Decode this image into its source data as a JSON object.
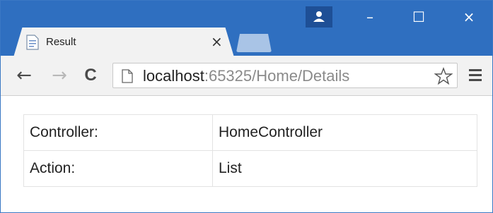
{
  "browser": {
    "tab_title": "Result",
    "tab_close_glyph": "×",
    "window_controls": {
      "minimize": "–",
      "maximize": "☐",
      "close": "×"
    },
    "url_host": "localhost",
    "url_path": ":65325/Home/Details",
    "icons": [
      "user-icon",
      "back-icon",
      "forward-icon",
      "reload-icon",
      "page-icon",
      "star-icon",
      "menu-icon"
    ]
  },
  "nav": {
    "back": "←",
    "forward": "→",
    "reload": "C"
  },
  "table": {
    "rows": [
      {
        "key": "Controller:",
        "value": "HomeController"
      },
      {
        "key": "Action:",
        "value": "List"
      }
    ]
  },
  "colors": {
    "titlebar": "#2f6fc0",
    "toolbar": "#f2f2f2",
    "border": "#e3e3e3"
  }
}
